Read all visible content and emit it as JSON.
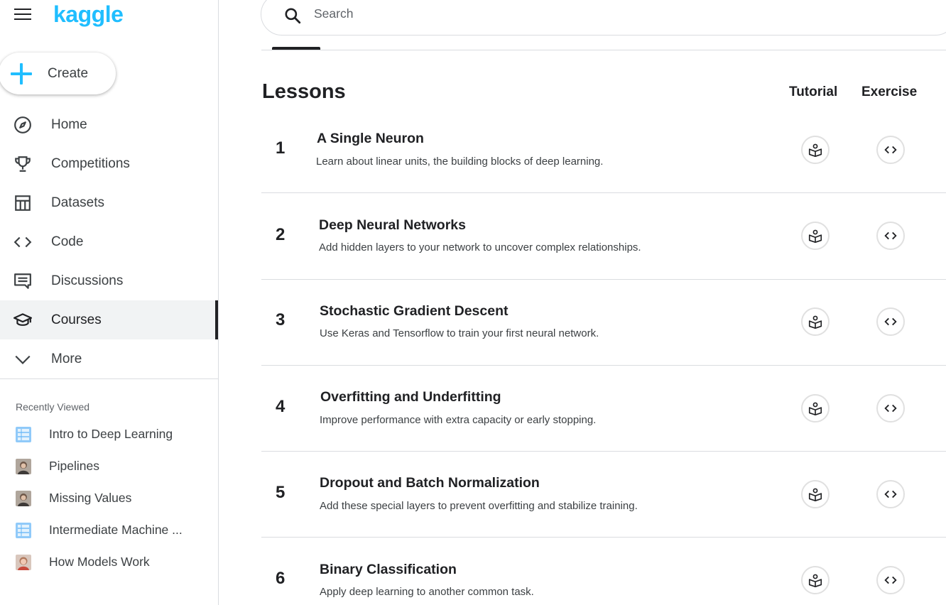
{
  "app": {
    "logo": "kaggle"
  },
  "sidebar": {
    "create_label": "Create",
    "nav": [
      {
        "label": "Home",
        "icon": "compass-icon"
      },
      {
        "label": "Competitions",
        "icon": "trophy-icon"
      },
      {
        "label": "Datasets",
        "icon": "table-icon"
      },
      {
        "label": "Code",
        "icon": "code-icon"
      },
      {
        "label": "Discussions",
        "icon": "comment-icon"
      },
      {
        "label": "Courses",
        "icon": "school-icon",
        "active": true
      },
      {
        "label": "More",
        "icon": "chevron-down-icon"
      }
    ],
    "recent_heading": "Recently Viewed",
    "recent": [
      {
        "label": "Intro to Deep Learning",
        "thumb": "course-thumb"
      },
      {
        "label": "Pipelines",
        "thumb": "avatar-thumb"
      },
      {
        "label": "Missing Values",
        "thumb": "avatar-thumb"
      },
      {
        "label": "Intermediate Machine ...",
        "thumb": "course-thumb"
      },
      {
        "label": "How Models Work",
        "thumb": "avatar-thumb-alt"
      }
    ]
  },
  "search": {
    "placeholder": "Search"
  },
  "lessons": {
    "title": "Lessons",
    "col_tutorial": "Tutorial",
    "col_exercise": "Exercise",
    "items": [
      {
        "num": "1",
        "title": "A Single Neuron",
        "desc": "Learn about linear units, the building blocks of deep learning."
      },
      {
        "num": "2",
        "title": "Deep Neural Networks",
        "desc": "Add hidden layers to your network to uncover complex relationships."
      },
      {
        "num": "3",
        "title": "Stochastic Gradient Descent",
        "desc": "Use Keras and Tensorflow to train your first neural network."
      },
      {
        "num": "4",
        "title": "Overfitting and Underfitting",
        "desc": "Improve performance with extra capacity or early stopping."
      },
      {
        "num": "5",
        "title": "Dropout and Batch Normalization",
        "desc": "Add these special layers to prevent overfitting and stabilize training."
      },
      {
        "num": "6",
        "title": "Binary Classification",
        "desc": "Apply deep learning to another common task."
      }
    ]
  },
  "colors": {
    "brand": "#20beff",
    "text": "#202124",
    "muted": "#5f6368",
    "border": "#dadce0"
  }
}
